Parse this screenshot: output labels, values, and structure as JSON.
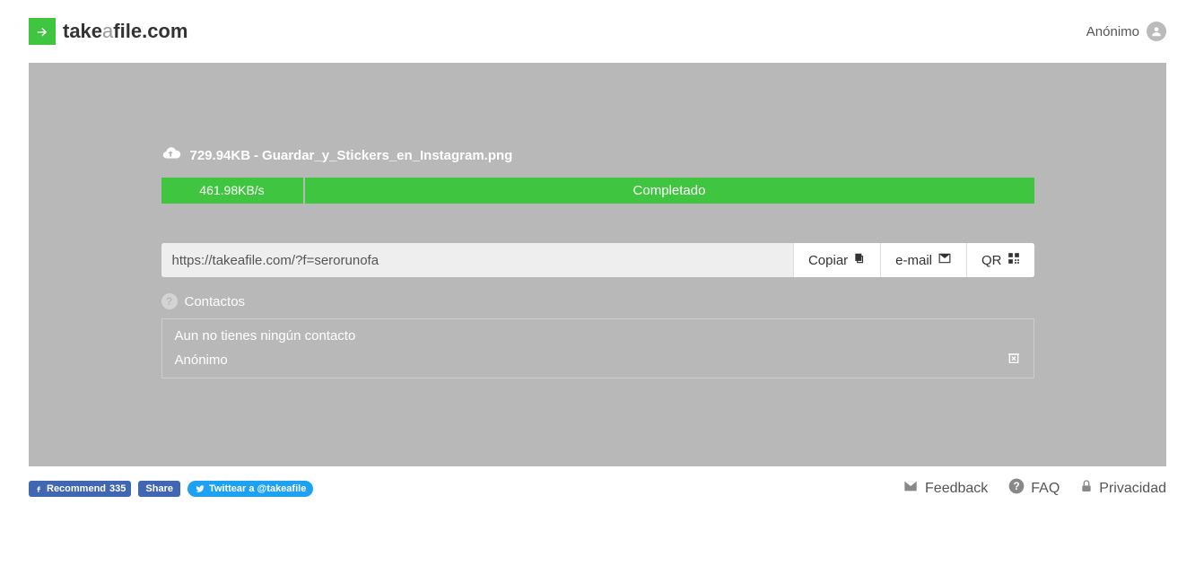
{
  "header": {
    "logo_take": "take",
    "logo_a": "a",
    "logo_file": "file.com",
    "user_label": "Anónimo"
  },
  "upload": {
    "file_size": "729.94KB",
    "separator": " - ",
    "file_name": "Guardar_y_Stickers_en_Instagram.png",
    "speed": "461.98KB/s",
    "status": "Completado"
  },
  "share": {
    "url": "https://takeafile.com/?f=serorunofa",
    "copy_label": "Copiar",
    "email_label": "e-mail",
    "qr_label": "QR"
  },
  "contacts": {
    "header": "Contactos",
    "empty_msg": "Aun no tienes ningún contacto",
    "anon": "Anónimo"
  },
  "social": {
    "recommend": "Recommend",
    "recommend_count": "335",
    "share": "Share",
    "twitter": "Twittear a @takeafile"
  },
  "footer": {
    "feedback": "Feedback",
    "faq": "FAQ",
    "privacy": "Privacidad"
  }
}
